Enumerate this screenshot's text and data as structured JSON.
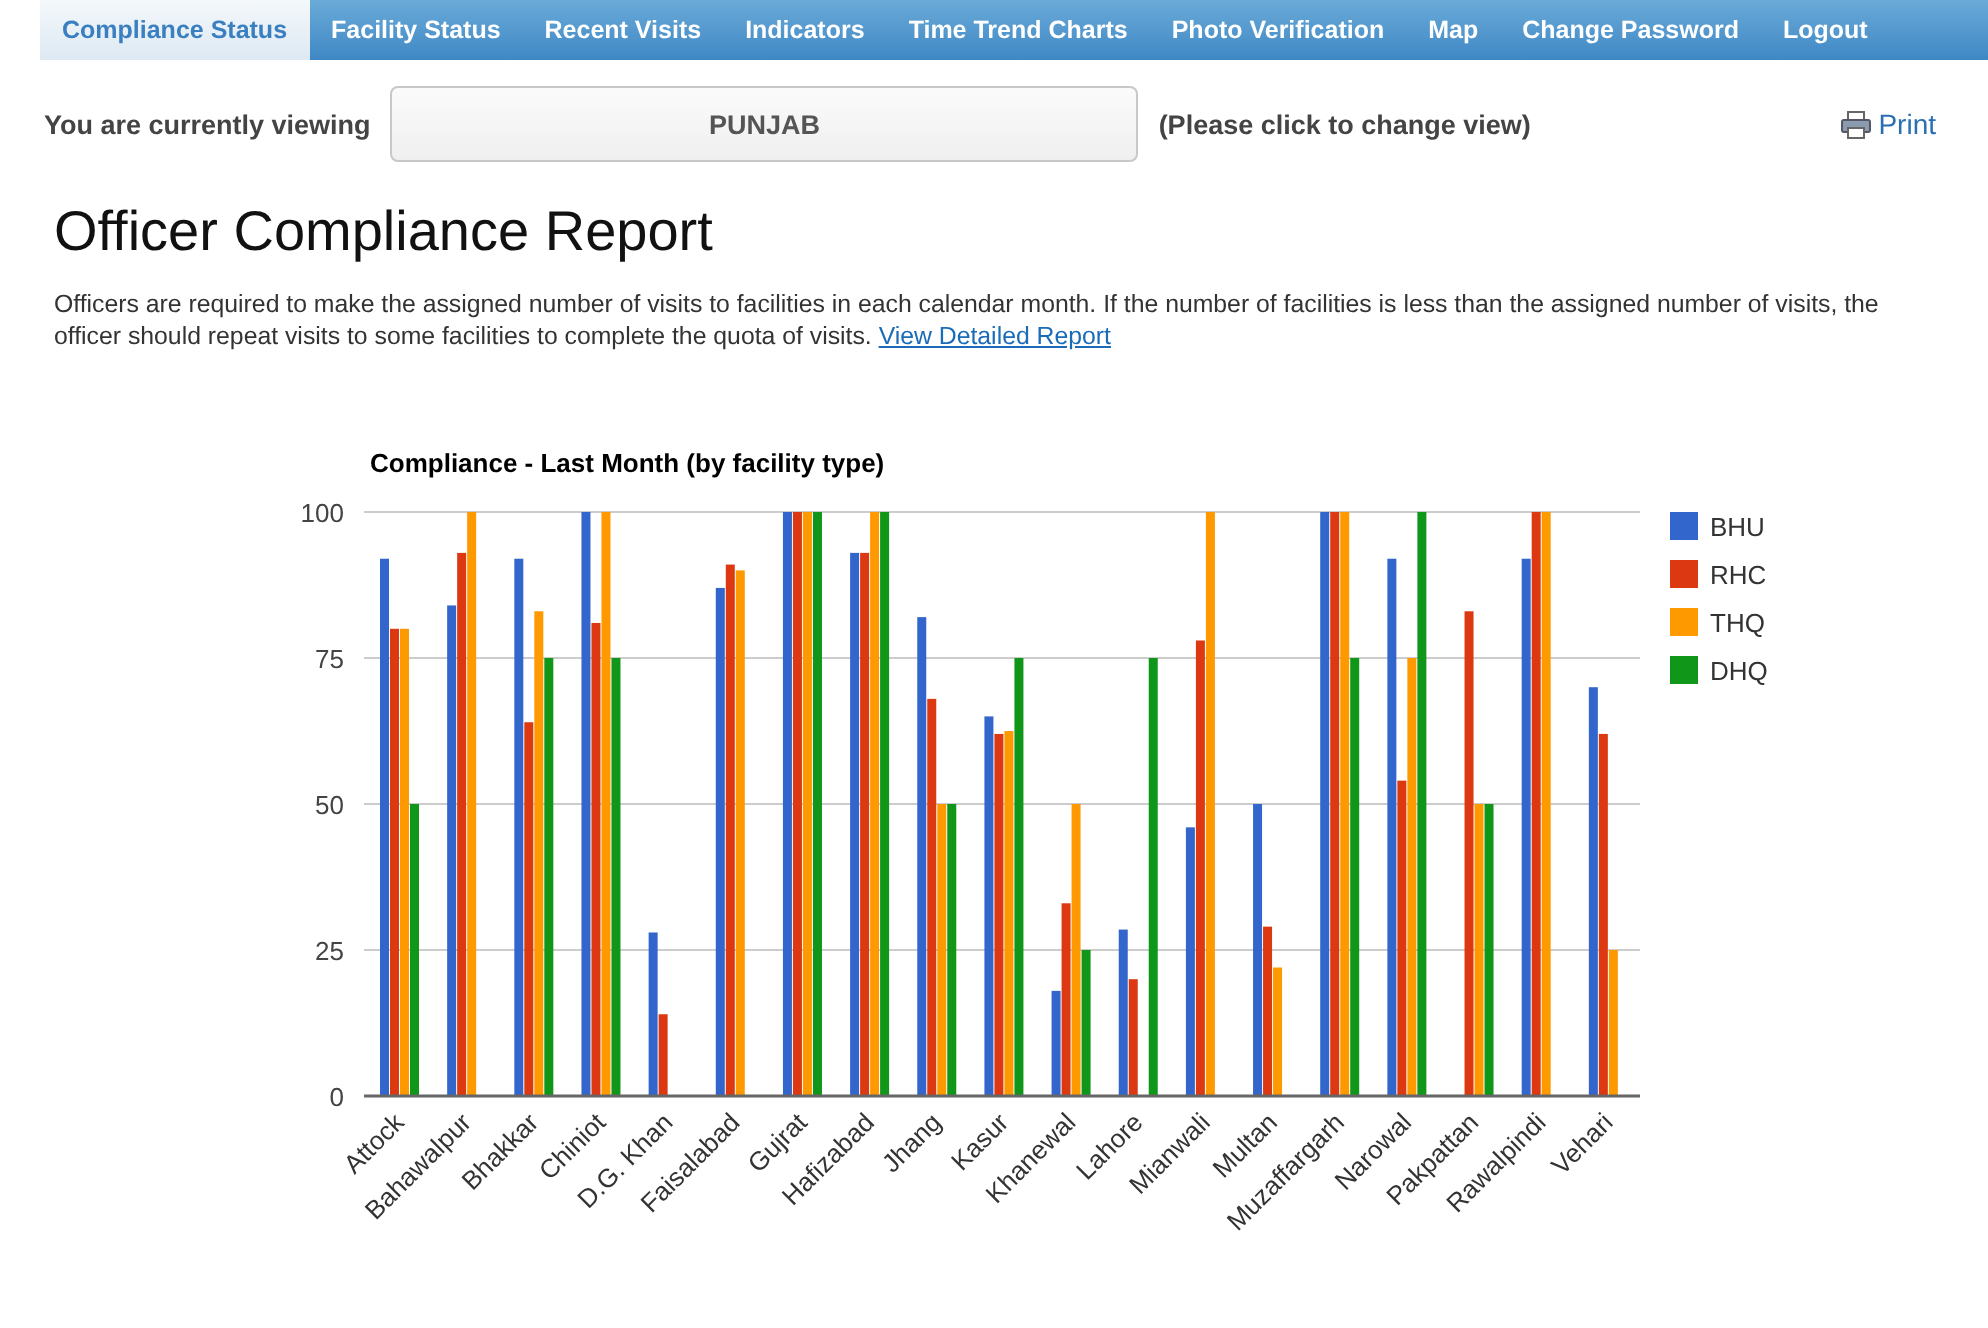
{
  "nav": [
    {
      "label": "Compliance Status",
      "selected": true
    },
    {
      "label": "Facility Status",
      "selected": false
    },
    {
      "label": "Recent Visits",
      "selected": false
    },
    {
      "label": "Indicators",
      "selected": false
    },
    {
      "label": "Time Trend Charts",
      "selected": false
    },
    {
      "label": "Photo Verification",
      "selected": false
    },
    {
      "label": "Map",
      "selected": false
    },
    {
      "label": "Change Password",
      "selected": false
    },
    {
      "label": "Logout",
      "selected": false
    }
  ],
  "viewing": {
    "label": "You are currently viewing",
    "value": "PUNJAB",
    "hint": "(Please click to change view)"
  },
  "print": "Print",
  "title": "Officer Compliance Report",
  "description": "Officers are required to make the assigned number of visits to facilities in each calendar month. If the number of facilities is less than the assigned number of visits, the officer should repeat visits to some facilities to complete the quota of visits.",
  "link": "View Detailed Report",
  "chart_data": {
    "type": "bar",
    "title": "Compliance - Last Month (by facility type)",
    "categories": [
      "Attock",
      "Bahawalpur",
      "Bhakkar",
      "Chiniot",
      "D.G. Khan",
      "Faisalabad",
      "Gujrat",
      "Hafizabad",
      "Jhang",
      "Kasur",
      "Khanewal",
      "Lahore",
      "Mianwali",
      "Multan",
      "Muzaffargarh",
      "Narowal",
      "Pakpattan",
      "Rawalpindi",
      "Vehari"
    ],
    "series": [
      {
        "name": "BHU",
        "color": "#3366cc",
        "values": [
          92,
          84,
          92,
          100,
          28,
          87,
          100,
          93,
          82,
          65,
          18,
          28.5,
          46,
          50,
          100,
          92,
          null,
          92,
          70
        ]
      },
      {
        "name": "RHC",
        "color": "#dc3912",
        "values": [
          80,
          93,
          64,
          81,
          14,
          91,
          100,
          93,
          68,
          62,
          33,
          20,
          78,
          29,
          100,
          54,
          83,
          100,
          62
        ]
      },
      {
        "name": "THQ",
        "color": "#ff9900",
        "values": [
          80,
          100,
          83,
          100,
          null,
          90,
          100,
          100,
          50,
          62.5,
          50,
          null,
          100,
          22,
          100,
          75,
          50,
          100,
          25
        ]
      },
      {
        "name": "DHQ",
        "color": "#109618",
        "values": [
          50,
          null,
          75,
          75,
          null,
          null,
          100,
          100,
          50,
          75,
          25,
          75,
          null,
          null,
          75,
          100,
          50,
          null,
          null
        ]
      }
    ],
    "ylim": [
      0,
      100
    ],
    "yticks": [
      0,
      25,
      50,
      75,
      100
    ],
    "grid": true,
    "legend": "right"
  }
}
